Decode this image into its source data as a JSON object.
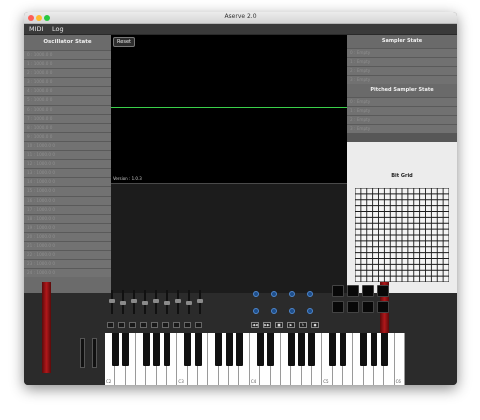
{
  "window": {
    "title": "Aserve 2.0"
  },
  "menu": [
    "MIDI",
    "Log"
  ],
  "oscillator_state": {
    "title": "Oscillator State",
    "rows": [
      "0 : 1000.0 0",
      "1 : 1000.0 0",
      "2 : 1000.0 0",
      "3 : 1000.0 0",
      "4 : 1000.0 0",
      "5 : 1000.0 0",
      "6 : 1000.0 0",
      "7 : 1000.0 0",
      "8 : 1000.0 0",
      "9 : 1000.0 0",
      "10 : 1000.0 0",
      "11 : 1000.0 0",
      "12 : 1000.0 0",
      "13 : 1000.0 0",
      "14 : 1000.0 0",
      "15 : 1000.0 0",
      "16 : 1000.0 0",
      "17 : 1000.0 0",
      "18 : 1000.0 0",
      "19 : 1000.0 0",
      "20 : 1000.0 0",
      "21 : 1000.0 0",
      "22 : 1000.0 0",
      "23 : 1000.0 0",
      "24 : 1000.0 0"
    ]
  },
  "scope": {
    "reset_label": "Reset",
    "version": "Version : 1.0.3"
  },
  "sampler_state": {
    "title": "Sampler State",
    "rows": [
      "0 : Empty",
      "1 : Empty",
      "2 : Empty",
      "3 : Empty"
    ]
  },
  "pitched_sampler_state": {
    "title": "Pitched Sampler State",
    "rows": [
      "0 : Empty",
      "1 : Empty",
      "2 : Empty",
      "3 : Empty"
    ]
  },
  "bit_grid": {
    "title": "Bit Grid",
    "size": 16
  },
  "controller": {
    "transport": [
      "◀◀",
      "▶▶",
      "■",
      "▶",
      "↻",
      "●"
    ],
    "octave_labels": [
      "C2",
      "C3",
      "C4",
      "C5",
      "C6"
    ]
  },
  "colors": {
    "scope_line": "#3ad04a",
    "knob": "#1e4e8a",
    "brand_red": "#b3181b"
  }
}
